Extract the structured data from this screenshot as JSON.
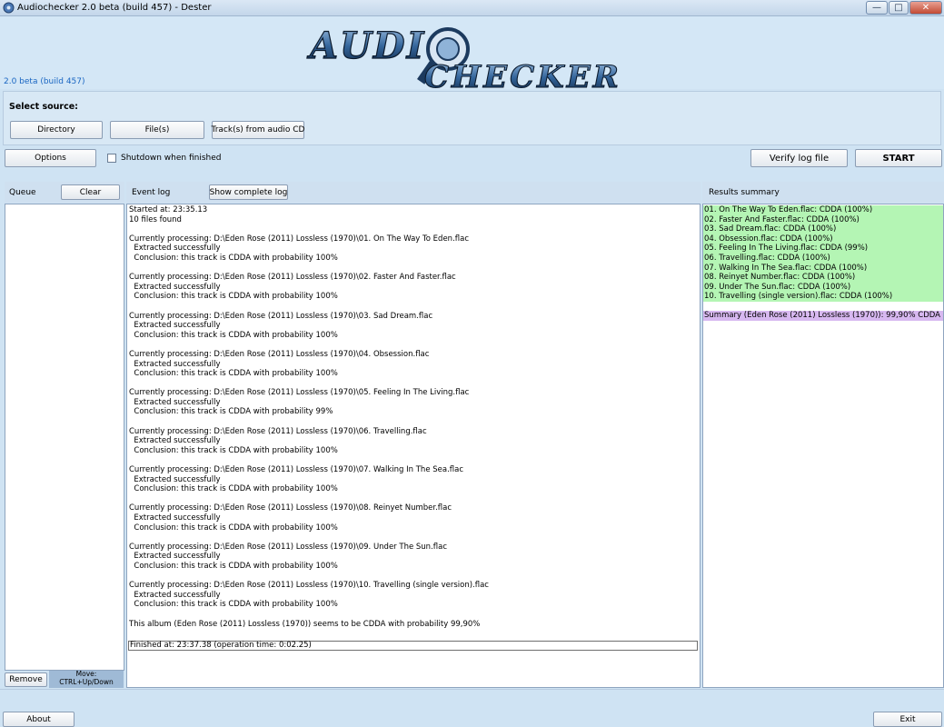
{
  "window": {
    "title": "Audiochecker 2.0 beta (build 457) - Dester",
    "minimize": "—",
    "maximize": "□",
    "close": "✕"
  },
  "header": {
    "logo_text": "AUDIO CHECKER",
    "version": "2.0 beta (build 457)"
  },
  "source": {
    "label": "Select source:",
    "directory": "Directory",
    "files": "File(s)",
    "cd_tracks": "Track(s) from audio CD"
  },
  "controls": {
    "options": "Options",
    "shutdown_label": "Shutdown when finished",
    "shutdown_checked": false,
    "verify": "Verify log file",
    "start": "START"
  },
  "queue": {
    "label": "Queue",
    "clear": "Clear",
    "remove": "Remove",
    "move_line1": "Move:",
    "move_line2": "CTRL+Up/Down"
  },
  "event_log": {
    "label": "Event log",
    "show_complete": "Show complete log",
    "lines": [
      "Started at: 23:35.13",
      "10 files found",
      "",
      "Currently processing: D:\\Eden Rose (2011) Lossless (1970)\\01. On The Way To Eden.flac",
      "  Extracted successfully",
      "  Conclusion: this track is CDDA with probability 100%",
      "",
      "Currently processing: D:\\Eden Rose (2011) Lossless (1970)\\02. Faster And Faster.flac",
      "  Extracted successfully",
      "  Conclusion: this track is CDDA with probability 100%",
      "",
      "Currently processing: D:\\Eden Rose (2011) Lossless (1970)\\03. Sad Dream.flac",
      "  Extracted successfully",
      "  Conclusion: this track is CDDA with probability 100%",
      "",
      "Currently processing: D:\\Eden Rose (2011) Lossless (1970)\\04. Obsession.flac",
      "  Extracted successfully",
      "  Conclusion: this track is CDDA with probability 100%",
      "",
      "Currently processing: D:\\Eden Rose (2011) Lossless (1970)\\05. Feeling In The Living.flac",
      "  Extracted successfully",
      "  Conclusion: this track is CDDA with probability 99%",
      "",
      "Currently processing: D:\\Eden Rose (2011) Lossless (1970)\\06. Travelling.flac",
      "  Extracted successfully",
      "  Conclusion: this track is CDDA with probability 100%",
      "",
      "Currently processing: D:\\Eden Rose (2011) Lossless (1970)\\07. Walking In The Sea.flac",
      "  Extracted successfully",
      "  Conclusion: this track is CDDA with probability 100%",
      "",
      "Currently processing: D:\\Eden Rose (2011) Lossless (1970)\\08. Reinyet Number.flac",
      "  Extracted successfully",
      "  Conclusion: this track is CDDA with probability 100%",
      "",
      "Currently processing: D:\\Eden Rose (2011) Lossless (1970)\\09. Under The Sun.flac",
      "  Extracted successfully",
      "  Conclusion: this track is CDDA with probability 100%",
      "",
      "Currently processing: D:\\Eden Rose (2011) Lossless (1970)\\10. Travelling (single version).flac",
      "  Extracted successfully",
      "  Conclusion: this track is CDDA with probability 100%",
      "",
      "This album (Eden Rose (2011) Lossless (1970)) seems to be CDDA with probability 99,90%",
      ""
    ],
    "finished": "Finished at: 23:37.38 (operation time: 0:02.25)"
  },
  "results": {
    "label": "Results summary",
    "items": [
      "01. On The Way To Eden.flac: CDDA (100%)",
      "02. Faster And Faster.flac: CDDA (100%)",
      "03. Sad Dream.flac: CDDA (100%)",
      "04. Obsession.flac: CDDA (100%)",
      "05. Feeling In The Living.flac: CDDA (99%)",
      "06. Travelling.flac: CDDA (100%)",
      "07. Walking In The Sea.flac: CDDA (100%)",
      "08. Reinyet Number.flac: CDDA (100%)",
      "09. Under The Sun.flac: CDDA (100%)",
      "10. Travelling (single version).flac: CDDA (100%)"
    ],
    "summary": "Summary (Eden Rose (2011) Lossless (1970)): 99,90% CDDA",
    "item_color": "#b4f5b4",
    "summary_color": "#d7b8f0"
  },
  "footer": {
    "about": "About",
    "exit": "Exit"
  }
}
